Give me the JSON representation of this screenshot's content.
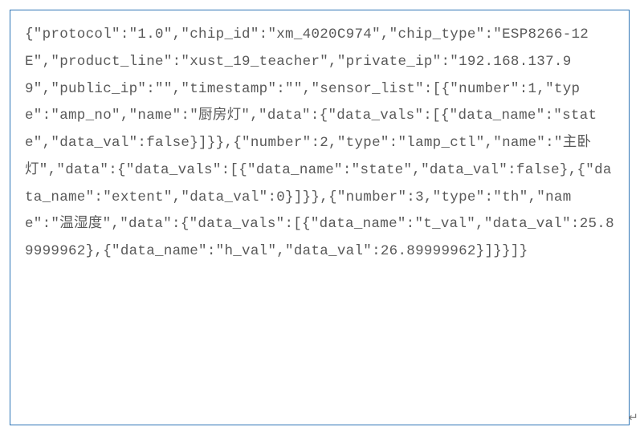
{
  "code": {
    "text": "{\"protocol\":\"1.0\",\"chip_id\":\"xm_4020C974\",\"chip_type\":\"ESP8266-12E\",\"product_line\":\"xust_19_teacher\",\"private_ip\":\"192.168.137.99\",\"public_ip\":\"\",\"timestamp\":\"\",\"sensor_list\":[{\"number\":1,\"type\":\"amp_no\",\"name\":\"厨房灯\",\"data\":{\"data_vals\":[{\"data_name\":\"state\",\"data_val\":false}]}},{\"number\":2,\"type\":\"lamp_ctl\",\"name\":\"主卧灯\",\"data\":{\"data_vals\":[{\"data_name\":\"state\",\"data_val\":false},{\"data_name\":\"extent\",\"data_val\":0}]}},{\"number\":3,\"type\":\"th\",\"name\":\"温湿度\",\"data\":{\"data_vals\":[{\"data_name\":\"t_val\",\"data_val\":25.89999962},{\"data_name\":\"h_val\",\"data_val\":26.89999962}]}}]}"
  },
  "cursor_glyph": "↵"
}
